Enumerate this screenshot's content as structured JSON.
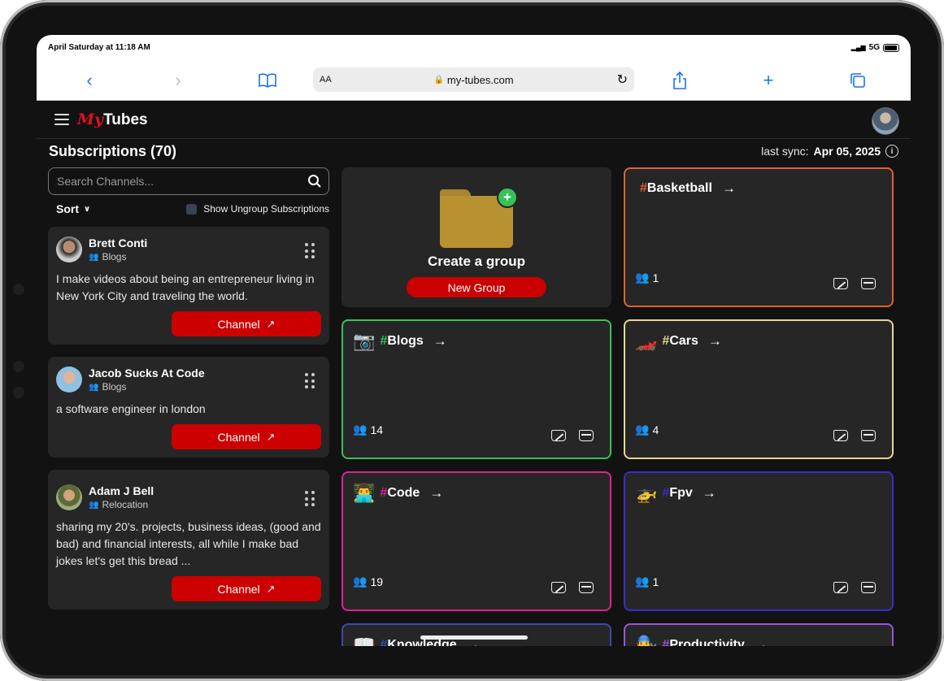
{
  "status_bar": {
    "time": "April Saturday at 11:18 AM",
    "signal": "5G"
  },
  "browser": {
    "aa": "AA",
    "url": "my-tubes.com"
  },
  "app": {
    "logo_my": "My",
    "logo_tubes": "Tubes"
  },
  "subscriptions": {
    "title": "Subscriptions (70)",
    "last_sync_label": "last sync:",
    "last_sync_date": "Apr 05, 2025",
    "search_placeholder": "Search Channels...",
    "sort_label": "Sort",
    "ungroup_label": "Show Ungroup Subscriptions",
    "channels": [
      {
        "name": "Brett Conti",
        "group": "Blogs",
        "description": "I make videos about being an entrepreneur living in New York City and traveling the world.",
        "button": "Channel"
      },
      {
        "name": "Jacob Sucks At Code",
        "group": "Blogs",
        "description": "a software engineer in london",
        "button": "Channel"
      },
      {
        "name": "Adam J Bell",
        "group": "Relocation",
        "description": "sharing my 20's. projects, business ideas, (good and bad) and financial interests, all while I make bad jokes let's get this bread ...",
        "button": "Channel"
      }
    ]
  },
  "create_group": {
    "title": "Create a group",
    "button": "New Group"
  },
  "groups": [
    {
      "name": "Basketball",
      "emoji": "",
      "count": "1",
      "color": "#e0622d"
    },
    {
      "name": "Blogs",
      "emoji": "📷",
      "count": "14",
      "color": "#37c15a"
    },
    {
      "name": "Cars",
      "emoji": "🏎️",
      "count": "4",
      "color": "#e6d98a"
    },
    {
      "name": "Code",
      "emoji": "👨‍💻",
      "count": "19",
      "color": "#e0228f"
    },
    {
      "name": "Fpv",
      "emoji": "🚁",
      "count": "1",
      "color": "#3a2ccf"
    },
    {
      "name": "Knowledge",
      "emoji": "📖",
      "count": "",
      "color": "#3b4aa8"
    },
    {
      "name": "Productivity",
      "emoji": "🧑‍🔧",
      "count": "",
      "color": "#9b55d6"
    }
  ]
}
